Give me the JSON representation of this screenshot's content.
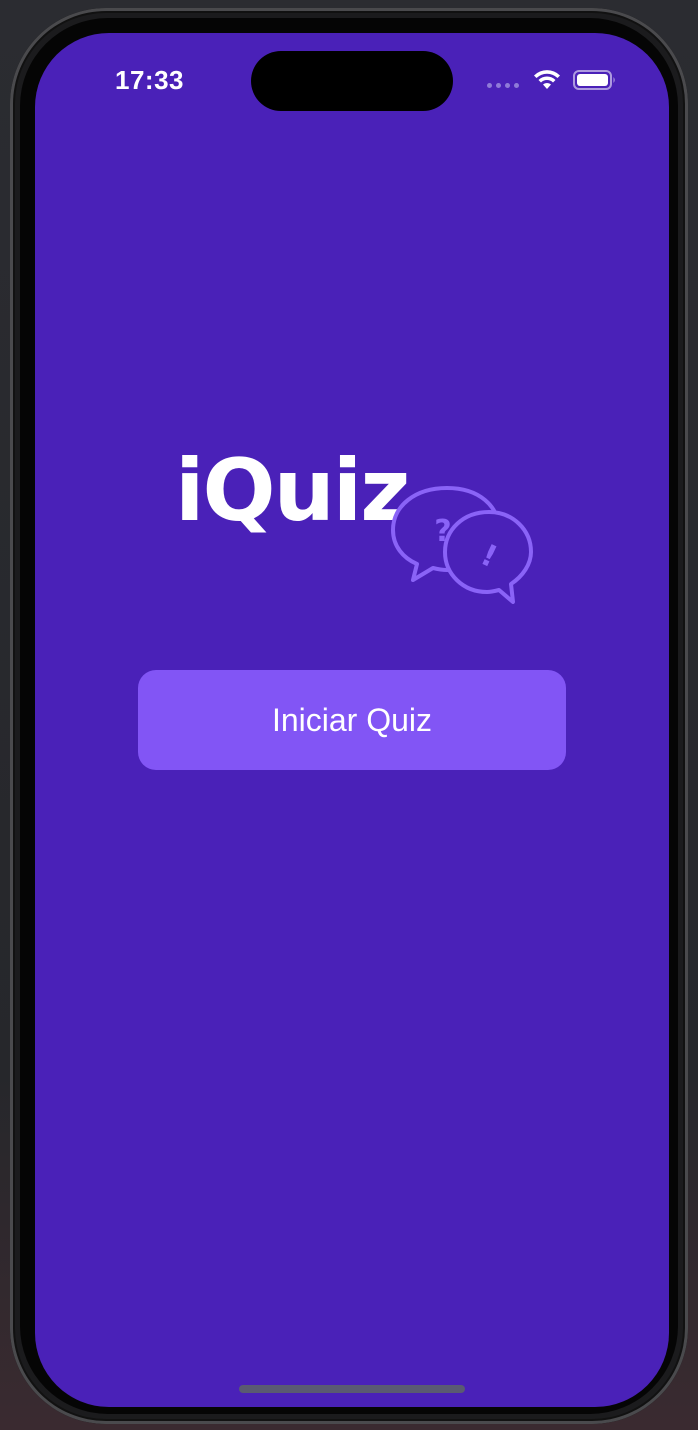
{
  "status_bar": {
    "time": "17:33",
    "icons": [
      "signal-dots-icon",
      "wifi-icon",
      "battery-icon"
    ]
  },
  "logo": {
    "text": "iQuiz",
    "icon": "chat-bubbles-icon",
    "bubble_marks": [
      "?",
      "!"
    ]
  },
  "main": {
    "start_button_label": "Iniciar Quiz"
  },
  "colors": {
    "background": "#4a21b8",
    "button": "#8255f5",
    "logo_accent": "#8a63f7",
    "text": "#ffffff"
  }
}
